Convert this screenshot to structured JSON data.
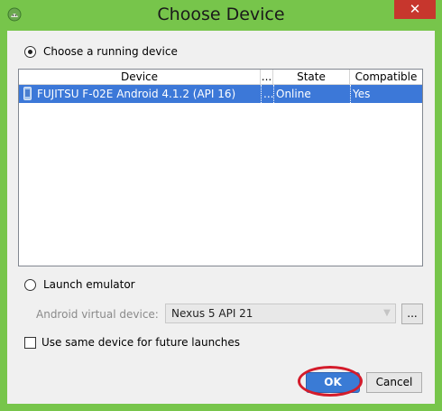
{
  "window": {
    "title": "Choose Device",
    "close_glyph": "✕",
    "app_icon": "android-icon"
  },
  "running": {
    "label": "Choose a running device",
    "selected": true
  },
  "table": {
    "columns": [
      "Device",
      "...",
      "State",
      "Compatible"
    ],
    "rows": [
      {
        "device": "FUJITSU F-02E Android 4.1.2 (API 16)",
        "extra": "...",
        "state": "Online",
        "compatible": "Yes",
        "icon": "phone-icon"
      }
    ]
  },
  "emulator": {
    "label": "Launch emulator",
    "selected": false,
    "avd_label": "Android virtual device:",
    "avd_value": "Nexus 5 API 21",
    "browse_label": "..."
  },
  "same_device": {
    "label": "Use same device for future launches",
    "checked": false
  },
  "buttons": {
    "ok": "OK",
    "cancel": "Cancel"
  },
  "colors": {
    "title_bar": "#77c54b",
    "selection": "#3c78d8",
    "close": "#c7362d",
    "highlight_ring": "#d41c2b"
  }
}
